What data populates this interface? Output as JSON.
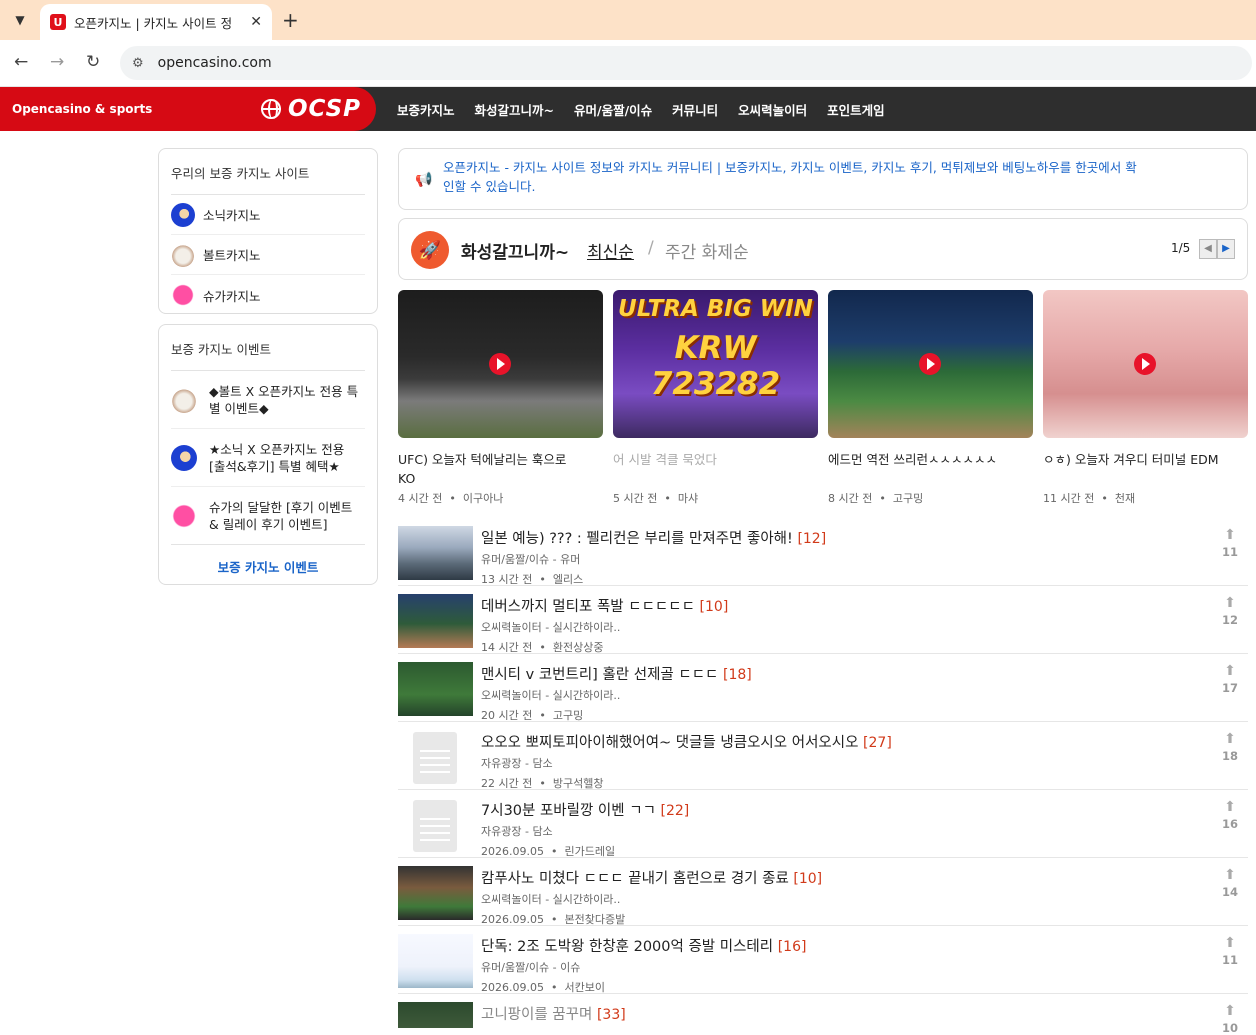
{
  "browser": {
    "tab_title": "오픈카지노 | 카지노 사이트 정",
    "url": "opencasino.com"
  },
  "header": {
    "brand": "Opencasino & sports",
    "logo": "OCSP",
    "nav": [
      "보증카지노",
      "화성갈끄니까~",
      "유머/움짤/이슈",
      "커뮤니티",
      "오씨력놀이터",
      "포인트게임"
    ]
  },
  "sidebar": {
    "casinos": {
      "title": "우리의 보증 카지노 사이트",
      "items": [
        {
          "label": "소닉카지노",
          "icon": "sonic-avatar"
        },
        {
          "label": "볼트카지노",
          "icon": "bolt-avatar"
        },
        {
          "label": "슈가카지노",
          "icon": "sugar-avatar"
        }
      ]
    },
    "events": {
      "title": "보증 카지노 이벤트",
      "items": [
        {
          "line1": "◆볼트 X 오픈카지노 전용 특",
          "line2": "별 이벤트◆"
        },
        {
          "line1": "★소닉 X 오픈카지노 전용",
          "line2": "[출석&후기] 특별 혜택★"
        },
        {
          "line1": "슈가의 달달한 [후기 이벤트",
          "line2": "& 릴레이 후기 이벤트]"
        }
      ],
      "more": "보증 카지노 이벤트"
    }
  },
  "notice": {
    "line1": "오픈카지노 - 카지노 사이트 정보와 카지노 커뮤니티 | 보증카지노, 카지노 이벤트, 카지노 후기, 먹튀제보와 베팅노하우를 한곳에서 확",
    "line2": "인할 수 있습니다."
  },
  "section": {
    "title": "화성갈끄니까~",
    "sort_active": "최신순",
    "separator": "/",
    "sort_other": "주간 화제순",
    "pager": "1/5"
  },
  "cards": [
    {
      "title_l1": "UFC) 오늘자 턱에날리는 훅으로",
      "title_l2": "KO",
      "time": "4 시간 전",
      "author": "이구아나",
      "muted": false
    },
    {
      "title_l1": "어 시발 격클 묵었다",
      "title_l2": "",
      "time": "5 시간 전",
      "author": "마샤",
      "muted": true,
      "overlay_l1": "ULTRA BIG WIN",
      "overlay_l2": "KRW 723282"
    },
    {
      "title_l1": "에드먼 역전 쓰리런ㅅㅅㅅㅅㅅㅅ",
      "title_l2": "",
      "time": "8 시간 전",
      "author": "고구밍",
      "muted": false
    },
    {
      "title_l1": "ㅇㅎ) 오늘자 겨우디 터미널 EDM",
      "title_l2": "",
      "time": "11 시간 전",
      "author": "천재",
      "muted": false
    }
  ],
  "posts": [
    {
      "title": "일본 예능) ??? : 펠리컨은 부리를 만져주면 좋아해!",
      "comments": "[12]",
      "category": "유머/움짤/이슈 - 유머",
      "time": "13 시간 전",
      "author": "엘리스",
      "votes": "11"
    },
    {
      "title": "데버스까지 멀티포 폭발 ㄷㄷㄷㄷㄷ",
      "comments": "[10]",
      "category": "오씨력놀이터 - 실시간하이라..",
      "time": "14 시간 전",
      "author": "환전상상중",
      "votes": "12"
    },
    {
      "title": "맨시티 v 코번트리] 홀란 선제골 ㄷㄷㄷ",
      "comments": "[18]",
      "category": "오씨력놀이터 - 실시간하이라..",
      "time": "20 시간 전",
      "author": "고구밍",
      "votes": "17"
    },
    {
      "title": "오오오 뽀찌토피아이해했어여~ 댓글들 냉큼오시오 어서오시오",
      "comments": "[27]",
      "category": "자유광장 - 담소",
      "time": "22 시간 전",
      "author": "방구석헬창",
      "votes": "18"
    },
    {
      "title": "7시30분 포바릴깡 이벤 ㄱㄱ",
      "comments": "[22]",
      "category": "자유광장 - 담소",
      "time": "2026.09.05",
      "author": "린가드레일",
      "votes": "16"
    },
    {
      "title": "캄푸사노 미쳤다 ㄷㄷㄷ 끝내기 홈런으로 경기 종료",
      "comments": "[10]",
      "category": "오씨력놀이터 - 실시간하이라..",
      "time": "2026.09.05",
      "author": "본전찾다증발",
      "votes": "14"
    },
    {
      "title": "단독: 2조 도박왕 한창훈 2000억 증발 미스테리",
      "comments": "[16]",
      "category": "유머/움짤/이슈 - 이슈",
      "time": "2026.09.05",
      "author": "서칸보이",
      "votes": "11"
    },
    {
      "title": "고니팡이를 꿈꾸며",
      "comments": "[33]",
      "category": "",
      "time": "",
      "author": "",
      "votes": "10"
    }
  ]
}
